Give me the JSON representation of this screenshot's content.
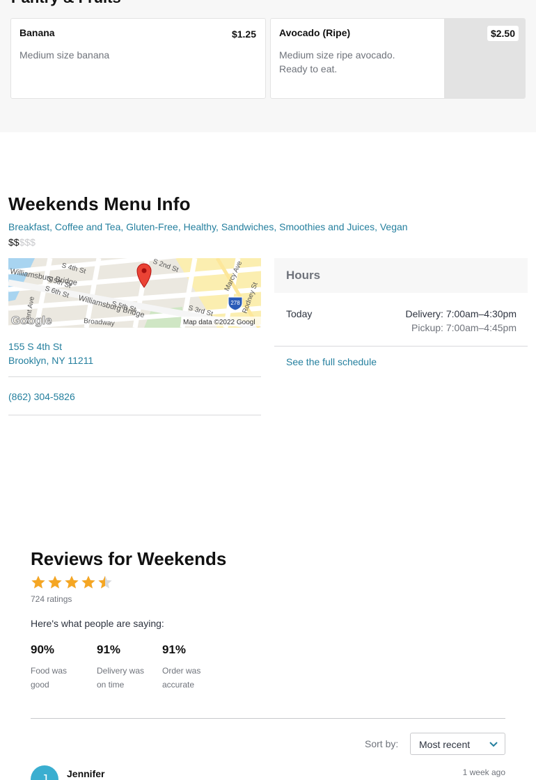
{
  "menu_section": {
    "heading": "Pantry & Fruits",
    "items": [
      {
        "name": "Banana",
        "price": "$1.25",
        "description": "Medium size banana"
      },
      {
        "name": "Avocado (Ripe)",
        "price": "$2.50",
        "description": "Medium size ripe avocado. Ready to eat."
      }
    ]
  },
  "info": {
    "title": "Weekends Menu Info",
    "tags": "Breakfast, Coffee and Tea, Gluten-Free, Healthy, Sandwiches, Smoothies and Juices, Vegan",
    "price_tier_active": "$$",
    "price_tier_inactive": "$$$",
    "map": {
      "streets": [
        "S 4th St",
        "S 2nd St",
        "Williamsburg Bridge",
        "S 5th St",
        "S 6th St",
        "Williamsburg Bridge",
        "S 5th St",
        "S 3rd St",
        "Broadway",
        "Marcy Ave",
        "Rodney St",
        "Kent Ave"
      ],
      "highway_shield": "278",
      "logo": "Google",
      "attribution": "Map data ©2022 Googl"
    },
    "address_line1": "155 S 4th St",
    "address_line2": "Brooklyn, NY 11211",
    "phone": "(862) 304-5826",
    "hours": {
      "title": "Hours",
      "today_label": "Today",
      "delivery": "Delivery: 7:00am–4:30pm",
      "pickup": "Pickup: 7:00am–4:45pm",
      "schedule_link": "See the full schedule"
    }
  },
  "reviews": {
    "title": "Reviews for Weekends",
    "rating": 4.5,
    "ratings_count": "724 ratings",
    "saying": "Here's what people are saying:",
    "stats": [
      {
        "pct": "90%",
        "label": "Food was good"
      },
      {
        "pct": "91%",
        "label": "Delivery was on time"
      },
      {
        "pct": "91%",
        "label": "Order was accurate"
      }
    ],
    "sort_label": "Sort by:",
    "sort_value": "Most recent",
    "first_review": {
      "name": "Jennifer",
      "initial": "J",
      "time": "1 week ago"
    }
  },
  "colors": {
    "link": "#247f9e",
    "star": "#f5a623",
    "avatar": "#3aaed0"
  }
}
